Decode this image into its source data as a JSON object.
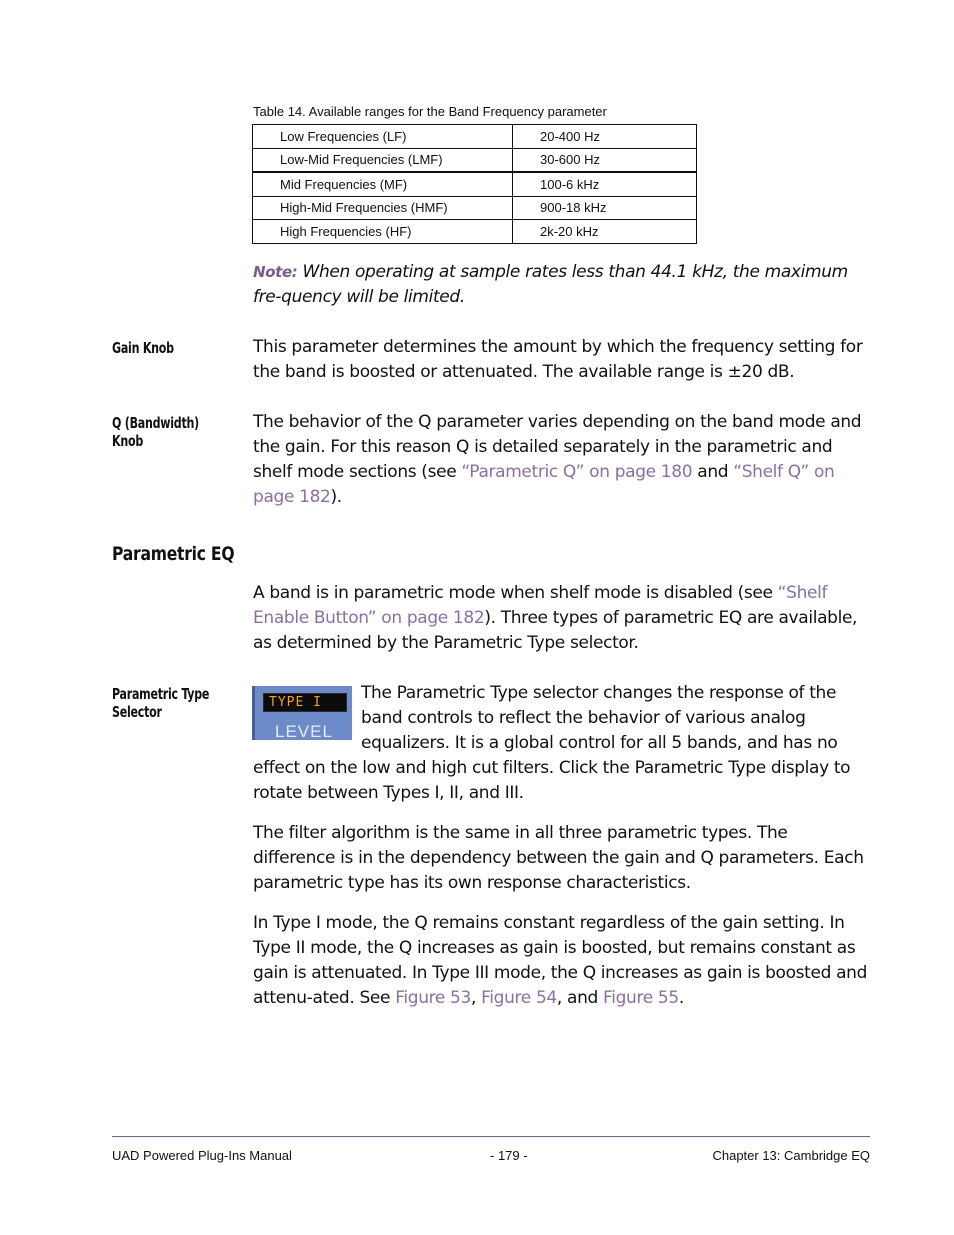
{
  "table": {
    "caption": "Table 14. Available ranges for the Band Frequency parameter",
    "rows": [
      {
        "band": "Low Frequencies (LF)",
        "range": "20-400 Hz"
      },
      {
        "band": "Low-Mid Frequencies (LMF)",
        "range": "30-600 Hz"
      },
      {
        "band": "Mid Frequencies (MF)",
        "range": "100-6 kHz"
      },
      {
        "band": "High-Mid Frequencies (HMF)",
        "range": "900-18 kHz"
      },
      {
        "band": "High Frequencies (HF)",
        "range": "2k-20 kHz"
      }
    ]
  },
  "note": {
    "label": "Note:",
    "text": " When operating at sample rates less than 44.1 kHz, the maximum fre-quency will be limited."
  },
  "gain_knob": {
    "heading": "Gain Knob",
    "text": "This parameter determines the amount by which the frequency setting for the band is boosted or attenuated. The available range is ±20 dB."
  },
  "q_knob": {
    "heading": "Q (Bandwidth) Knob",
    "text_1": "The behavior of the Q parameter varies depending on the band mode and the gain. For this reason Q is detailed separately in the parametric and shelf mode sections (see ",
    "link_1": "“Parametric Q” on page 180",
    "text_2": " and ",
    "link_2": "“Shelf Q” on page 182",
    "text_3": ")."
  },
  "parametric_eq": {
    "heading": "Parametric EQ",
    "text_1": "A band is in parametric mode when shelf mode is disabled (see ",
    "link_1": "“Shelf Enable Button” on page 182",
    "text_2": "). Three types of parametric EQ are available, as determined by the Parametric Type selector."
  },
  "parametric_type": {
    "heading": "Parametric Type Selector",
    "image": {
      "display": "TYPE I",
      "label": "LEVEL"
    },
    "para_1": "The Parametric Type selector changes the response of the band controls to reflect the behavior of various analog equalizers. It is a global control for all 5 bands, and has no effect on the low and high cut filters. Click the Parametric Type display to rotate between Types I, II, and III.",
    "para_2": "The filter algorithm is the same in all three parametric types. The difference is in the dependency between the gain and Q parameters. Each parametric type has its own response characteristics.",
    "para_3_text": "In Type I mode, the Q remains constant regardless of the gain setting. In Type II mode, the Q increases as gain is boosted, but remains constant as gain is attenuated. In Type III mode, the Q increases as gain is boosted and attenu-ated. See ",
    "fig_53": "Figure 53",
    "sep_1": ", ",
    "fig_54": "Figure 54",
    "sep_2": ", and ",
    "fig_55": "Figure 55",
    "end": "."
  },
  "footer": {
    "left": "UAD Powered Plug-Ins Manual",
    "center": "- 179 -",
    "right": "Chapter 13: Cambridge EQ"
  },
  "colors": {
    "link": "#8b6fa3",
    "note_label": "#7b5a8f",
    "rule": "#7b5a8f"
  }
}
